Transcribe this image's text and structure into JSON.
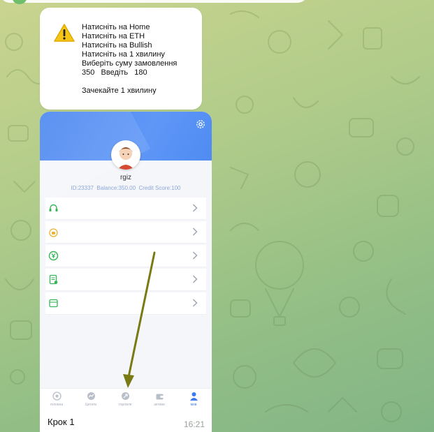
{
  "chat": {
    "instructions": [
      "Натисніть на Home",
      "Натисніть на ЕТН",
      "Натисніть на Bullish",
      "Натисніть на 1 хвилину",
      "Виберіть суму замовлення",
      "350   Введіть   180",
      "",
      "Зачекайте 1 хвилину"
    ],
    "warning_icon": "warning-icon"
  },
  "screenshot": {
    "username": "rgiz",
    "info": "ID:23337  Balance:350.00  Credit Score:100",
    "menu_icons": [
      "headset-icon",
      "lock-icon",
      "yuan-icon",
      "document-icon",
      "wallet-icon"
    ],
    "tabs": [
      {
        "label": "головна",
        "icon": "home-icon"
      },
      {
        "label": "Цитати",
        "icon": "quotes-icon"
      },
      {
        "label": "торгівля",
        "icon": "trade-icon"
      },
      {
        "label": "активи",
        "icon": "assets-icon"
      },
      {
        "label": "мов",
        "icon": "user-icon",
        "active": true
      }
    ],
    "colors": {
      "header": "#4a86f0",
      "accent": "#3d7af0",
      "menu_icon": "#35b557"
    }
  },
  "message": {
    "caption": "Крок 1",
    "time": "16:21"
  },
  "annotation": {
    "arrow_color": "#7a7a14"
  }
}
